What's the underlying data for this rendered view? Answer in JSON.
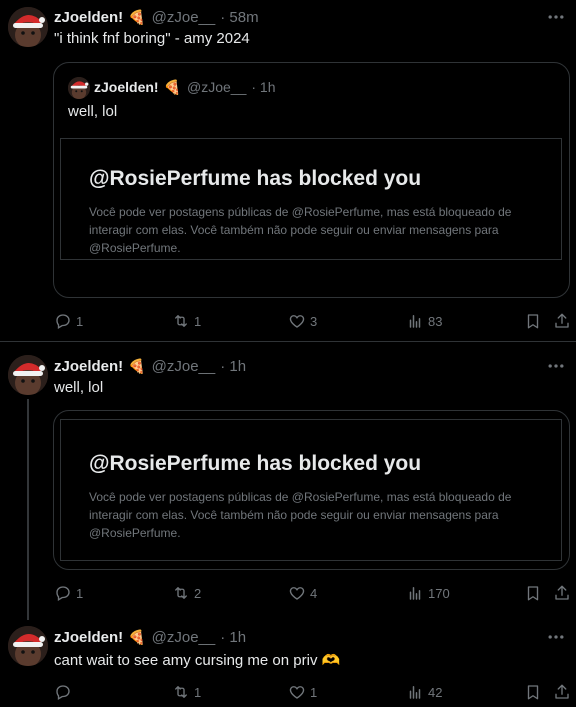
{
  "colors": {
    "background": "#000000",
    "text": "#e7e9ea",
    "muted": "#71767b",
    "border": "#2f3336"
  },
  "tweets": [
    {
      "name": "zJoelden!",
      "name_emoji": "🍕",
      "handle": "@zJoe__",
      "time": "· 58m",
      "text": "\"i think fnf boring\" - amy 2024",
      "quote": {
        "name": "zJoelden!",
        "name_emoji": "🍕",
        "handle": "@zJoe__",
        "time": "· 1h",
        "text": "well, lol",
        "card_title": "@RosiePerfume has blocked you",
        "card_body": "Você pode ver postagens públicas de @RosiePerfume, mas está bloqueado de interagir com elas. Você também não pode seguir ou enviar mensagens para @RosiePerfume."
      },
      "actions": {
        "replies": "1",
        "reposts": "1",
        "likes": "3",
        "views": "83"
      }
    },
    {
      "name": "zJoelden!",
      "name_emoji": "🍕",
      "handle": "@zJoe__",
      "time": "· 1h",
      "text": "well, lol",
      "card_title": "@RosiePerfume has blocked you",
      "card_body": "Você pode ver postagens públicas de @RosiePerfume, mas está bloqueado de interagir com elas. Você também não pode seguir ou enviar mensagens para @RosiePerfume.",
      "actions": {
        "replies": "1",
        "reposts": "2",
        "likes": "4",
        "views": "170"
      }
    },
    {
      "name": "zJoelden!",
      "name_emoji": "🍕",
      "handle": "@zJoe__",
      "time": "· 1h",
      "text": "cant wait to see amy cursing me on priv 🫶",
      "actions": {
        "replies": "",
        "reposts": "1",
        "likes": "1",
        "views": "42"
      }
    }
  ],
  "icons": [
    "more-icon",
    "reply-icon",
    "repost-icon",
    "like-icon",
    "views-icon",
    "bookmark-icon",
    "share-icon",
    "pizza-emoji",
    "santa-hat-avatar"
  ]
}
